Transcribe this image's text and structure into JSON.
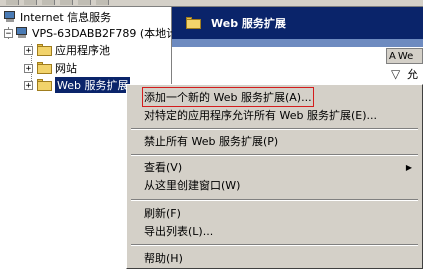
{
  "tree": {
    "root_label": "Internet 信息服务",
    "server_label": "VPS-63DABB2F789 (本地计",
    "items": [
      {
        "label": "应用程序池",
        "expander": "+"
      },
      {
        "label": "网站",
        "expander": "+"
      },
      {
        "label": "Web 服务扩展",
        "expander": "+"
      }
    ],
    "server_expander": "−"
  },
  "right_pane": {
    "header_title": "Web 服务扩展",
    "column_peek": "A",
    "column_peek_text": "We",
    "filter_peek_text": "允"
  },
  "context_menu": {
    "items": [
      {
        "label": "添加一个新的 Web 服务扩展(A)..."
      },
      {
        "label": "对特定的应用程序允许所有 Web 服务扩展(E)..."
      },
      {
        "label": "禁止所有 Web 服务扩展(P)"
      },
      {
        "label": "查看(V)"
      },
      {
        "label": "从这里创建窗口(W)"
      },
      {
        "label": "刷新(F)"
      },
      {
        "label": "导出列表(L)..."
      },
      {
        "label": "帮助(H)"
      }
    ],
    "submenu_arrow": "▶"
  },
  "colors": {
    "selection": "#0a246a",
    "menu_bg": "#d4d0c8",
    "highlight_box": "#d41c1c"
  }
}
